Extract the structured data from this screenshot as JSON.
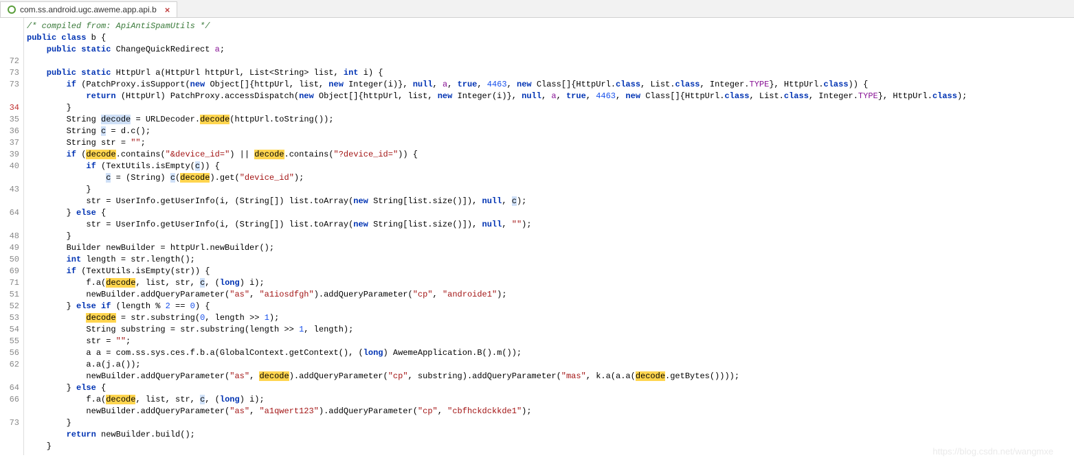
{
  "tab": {
    "label": "com.ss.android.ugc.aweme.app.api.b",
    "close": "×"
  },
  "gutter": [
    "",
    "",
    "",
    "72",
    "73",
    "73",
    "",
    "34",
    "35",
    "36",
    "37",
    "39",
    "40",
    "",
    "43",
    "",
    "64",
    "",
    "48",
    "49",
    "50",
    "69",
    "71",
    "51",
    "52",
    "53",
    "54",
    "55",
    "56",
    "62",
    "",
    "64",
    "66",
    "",
    "73",
    ""
  ],
  "gutter_red_indices": [
    7
  ],
  "code": {
    "l0": "/* compiled from: ApiAntiSpamUtils */",
    "l1_pre": "public class ",
    "l1_id": "b",
    "l1_post": " {",
    "l2_pre": "    public static ",
    "l2_ty": "ChangeQuickRedirect ",
    "l2_fld": "a",
    "l2_post": ";",
    "l3": "",
    "l4_a": "    public static ",
    "l4_b": "HttpUrl ",
    "l4_c": "a",
    "l4_d": "(HttpUrl httpUrl, List<String> list, ",
    "l4_e": "int",
    "l4_f": " i) {",
    "l5_a": "        if ",
    "l5_b": "(PatchProxy.isSupport(",
    "l5_c": "new ",
    "l5_d": "Object[]{httpUrl, list, ",
    "l5_e": "new ",
    "l5_f": "Integer(i)}, ",
    "l5_g": "null",
    "l5_h": ", ",
    "l5_fld": "a",
    "l5_i": ", ",
    "l5_j": "true",
    "l5_k": ", ",
    "l5_num": "4463",
    "l5_l": ", ",
    "l5_m": "new ",
    "l5_n": "Class[]{HttpUrl.",
    "l5_cls1": "class",
    "l5_o": ", List.",
    "l5_cls2": "class",
    "l5_p": ", Integer.",
    "l5_typ": "TYPE",
    "l5_q": "}, HttpUrl.",
    "l5_cls3": "class",
    "l5_r": ")) {",
    "l6_a": "            return ",
    "l6_b": "(HttpUrl) PatchProxy.accessDispatch(",
    "l6_c": "new ",
    "l6_d": "Object[]{httpUrl, list, ",
    "l6_e": "new ",
    "l6_f": "Integer(i)}, ",
    "l6_g": "null",
    "l6_h": ", ",
    "l6_fld": "a",
    "l6_i": ", ",
    "l6_j": "true",
    "l6_k": ", ",
    "l6_num": "4463",
    "l6_l": ", ",
    "l6_m": "new ",
    "l6_n": "Class[]{HttpUrl.",
    "l6_cls1": "class",
    "l6_o": ", List.",
    "l6_cls2": "class",
    "l6_p": ", Integer.",
    "l6_typ": "TYPE",
    "l6_q": "}, HttpUrl.",
    "l6_cls3": "class",
    "l6_r": ");",
    "l7": "        }",
    "l8_a": "        String ",
    "l8_sel": "decode",
    "l8_b": " = URLDecoder.",
    "l8_hl": "decode",
    "l8_c": "(httpUrl.toString());",
    "l9_a": "        String ",
    "l9_b": "c",
    "l9_c": " = d.c();",
    "l10_a": "        String str = ",
    "l10_s": "\"\"",
    "l10_b": ";",
    "l11_a": "        if ",
    "l11_b": "(",
    "l11_h1": "decode",
    "l11_c": ".contains(",
    "l11_s1": "\"&device_id=\"",
    "l11_d": ") || ",
    "l11_h2": "decode",
    "l11_e": ".contains(",
    "l11_s2": "\"?device_id=\"",
    "l11_f": ")) {",
    "l12_a": "            if ",
    "l12_b": "(TextUtils.isEmpty(",
    "l12_c": "c",
    "l12_d": ")) {",
    "l13_a": "                ",
    "l13_sel1": "c",
    "l13_b": " = (String) ",
    "l13_sel2": "c",
    "l13_c": "(",
    "l13_hl": "decode",
    "l13_d": ").get(",
    "l13_s": "\"device_id\"",
    "l13_e": ");",
    "l14": "            }",
    "l15_a": "            str = UserInfo.getUserInfo(i, (String[]) list.toArray(",
    "l15_b": "new ",
    "l15_c": "String[list.size()]), ",
    "l15_d": "null",
    "l15_e": ", ",
    "l15_sel": "c",
    "l15_f": ");",
    "l16_a": "        } ",
    "l16_b": "else ",
    "l16_c": "{",
    "l17_a": "            str = UserInfo.getUserInfo(i, (String[]) list.toArray(",
    "l17_b": "new ",
    "l17_c": "String[list.size()]), ",
    "l17_d": "null",
    "l17_e": ", ",
    "l17_s": "\"\"",
    "l17_f": ");",
    "l18": "        }",
    "l19": "        Builder newBuilder = httpUrl.newBuilder();",
    "l20_a": "        int ",
    "l20_b": "length = str.length();",
    "l21_a": "        if ",
    "l21_b": "(TextUtils.isEmpty(str)) {",
    "l22_a": "            f.a(",
    "l22_hl": "decode",
    "l22_b": ", list, str, ",
    "l22_sel": "c",
    "l22_c": ", (",
    "l22_kw": "long",
    "l22_d": ") i);",
    "l23_a": "            newBuilder.addQueryParameter(",
    "l23_s1": "\"as\"",
    "l23_b": ", ",
    "l23_s2": "\"a1iosdfgh\"",
    "l23_c": ").addQueryParameter(",
    "l23_s3": "\"cp\"",
    "l23_d": ", ",
    "l23_s4": "\"androide1\"",
    "l23_e": ");",
    "l24_a": "        } ",
    "l24_b": "else if ",
    "l24_c": "(length % ",
    "l24_n1": "2",
    "l24_d": " == ",
    "l24_n2": "0",
    "l24_e": ") {",
    "l25_a": "            ",
    "l25_hl": "decode",
    "l25_b": " = str.substring(",
    "l25_n1": "0",
    "l25_c": ", length >> ",
    "l25_n2": "1",
    "l25_d": ");",
    "l26_a": "            String substring = str.substring(length >> ",
    "l26_n": "1",
    "l26_b": ", length);",
    "l27_a": "            str = ",
    "l27_s": "\"\"",
    "l27_b": ";",
    "l28_a": "            a a = com.ss.sys.ces.f.b.a(GlobalContext.getContext(), (",
    "l28_kw": "long",
    "l28_b": ") AwemeApplication.B().m());",
    "l29": "            a.a(j.a());",
    "l30_a": "            newBuilder.addQueryParameter(",
    "l30_s1": "\"as\"",
    "l30_b": ", ",
    "l30_h1": "decode",
    "l30_c": ").addQueryParameter(",
    "l30_s2": "\"cp\"",
    "l30_d": ", substring).addQueryParameter(",
    "l30_s3": "\"mas\"",
    "l30_e": ", k.a(a.a(",
    "l30_h2": "decode",
    "l30_f": ".getBytes())));",
    "l31_a": "        } ",
    "l31_b": "else ",
    "l31_c": "{",
    "l32_a": "            f.a(",
    "l32_hl": "decode",
    "l32_b": ", list, str, ",
    "l32_sel": "c",
    "l32_c": ", (",
    "l32_kw": "long",
    "l32_d": ") i);",
    "l33_a": "            newBuilder.addQueryParameter(",
    "l33_s1": "\"as\"",
    "l33_b": ", ",
    "l33_s2": "\"a1qwert123\"",
    "l33_c": ").addQueryParameter(",
    "l33_s3": "\"cp\"",
    "l33_d": ", ",
    "l33_s4": "\"cbfhckdckkde1\"",
    "l33_e": ");",
    "l34": "        }",
    "l35_a": "        return ",
    "l35_b": "newBuilder.build();",
    "l36": "    }"
  },
  "watermark": "https://blog.csdn.net/wangmxe"
}
